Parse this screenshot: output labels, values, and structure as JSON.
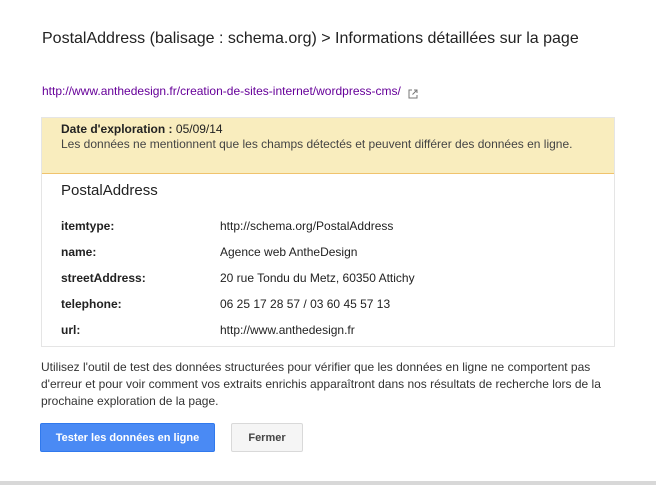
{
  "dialog": {
    "title": "PostalAddress (balisage : schema.org) > Informations détaillées sur la page"
  },
  "page_url": {
    "text": "http://www.anthedesign.fr/creation-de-sites-internet/wordpress-cms/",
    "icon": "external-link-icon"
  },
  "notice": {
    "date_label": "Date d'exploration :",
    "date_value": "05/09/14",
    "description": "Les données ne mentionnent que les champs détectés et peuvent différer des données en ligne."
  },
  "item": {
    "type": "PostalAddress",
    "properties": [
      {
        "name": "itemtype:",
        "value": "http://schema.org/PostalAddress"
      },
      {
        "name": "name:",
        "value": "Agence web AntheDesign"
      },
      {
        "name": "streetAddress:",
        "value": "20 rue Tondu du Metz, 60350 Attichy"
      },
      {
        "name": "telephone:",
        "value": "06 25 17 28 57 / 03 60 45 57 13"
      },
      {
        "name": "url:",
        "value": "http://www.anthedesign.fr"
      }
    ]
  },
  "help_text": "Utilisez l'outil de test des données structurées pour vérifier que les données en ligne ne comportent pas d'erreur et pour voir comment vos extraits enrichis apparaîtront dans nos résultats de recherche lors de la prochaine exploration de la page.",
  "buttons": {
    "test_label": "Tester les données en ligne",
    "close_label": "Fermer"
  },
  "colors": {
    "primary": "#4a8af4",
    "notice_bg": "#f9edbe",
    "link_visited": "#660099"
  }
}
